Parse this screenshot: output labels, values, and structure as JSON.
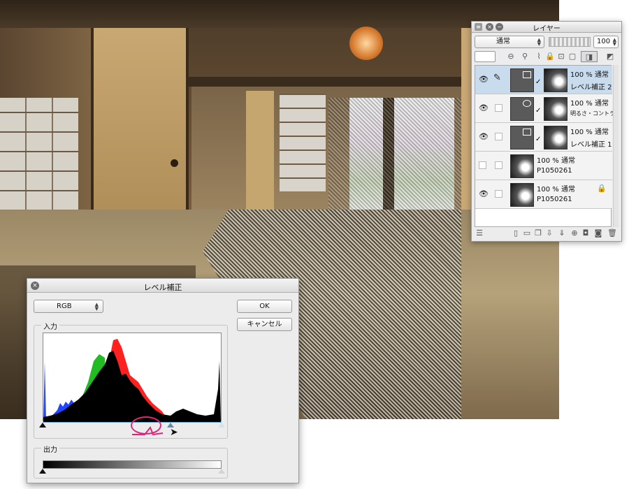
{
  "layer_panel": {
    "title": "レイヤー",
    "blend_mode": "通常",
    "opacity": "100",
    "layers": [
      {
        "opacity_mode": "100 % 通常",
        "name": "レベル補正 2",
        "visible": true,
        "selected": true,
        "type": "correction",
        "locked": false
      },
      {
        "opacity_mode": "100 % 通常",
        "name": "明るさ・コントラ",
        "visible": true,
        "selected": false,
        "type": "correction",
        "locked": false
      },
      {
        "opacity_mode": "100 % 通常",
        "name": "レベル補正 1",
        "visible": true,
        "selected": false,
        "type": "correction",
        "locked": false
      },
      {
        "opacity_mode": "100 % 通常",
        "name": "P1050261",
        "visible": false,
        "selected": false,
        "type": "raster",
        "locked": false
      },
      {
        "opacity_mode": "100 % 通常",
        "name": "P1050261",
        "visible": true,
        "selected": false,
        "type": "raster",
        "locked": true
      }
    ]
  },
  "levels_dialog": {
    "title": "レベル補正",
    "channel": "RGB",
    "ok_label": "OK",
    "cancel_label": "キャンセル",
    "input_label": "入力",
    "output_label": "出力",
    "input_black": 0,
    "input_gamma": 0.71,
    "input_white": 1,
    "output_black": 0,
    "output_white": 1
  },
  "colors": {
    "highlight": "#e0267c",
    "histogram_red": "#ff2020",
    "histogram_green": "#22bb22",
    "histogram_blue": "#2244ff",
    "selected_layer": "#c9dcee"
  }
}
